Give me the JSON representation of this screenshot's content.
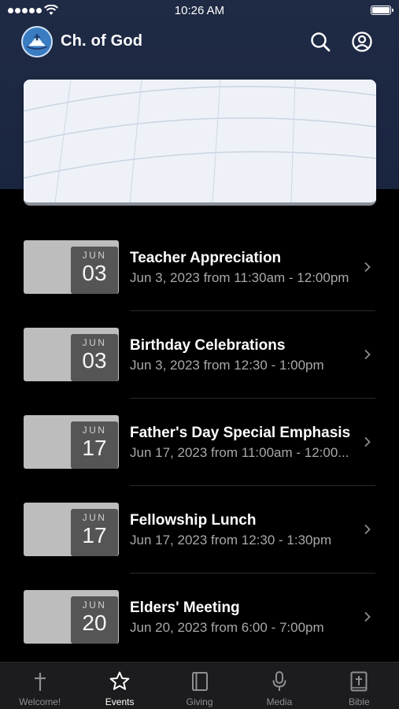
{
  "status_bar": {
    "time": "10:26 AM"
  },
  "header": {
    "title": "Ch. of God"
  },
  "events": [
    {
      "month": "JUN",
      "day": "03",
      "title": "Teacher Appreciation",
      "time": "Jun 3, 2023 from 11:30am - 12:00pm"
    },
    {
      "month": "JUN",
      "day": "03",
      "title": "Birthday Celebrations",
      "time": "Jun 3, 2023 from 12:30 - 1:00pm"
    },
    {
      "month": "JUN",
      "day": "17",
      "title": "Father's Day Special Emphasis",
      "time": "Jun 17, 2023 from 11:00am - 12:00..."
    },
    {
      "month": "JUN",
      "day": "17",
      "title": "Fellowship Lunch",
      "time": "Jun 17, 2023 from 12:30 - 1:30pm"
    },
    {
      "month": "JUN",
      "day": "20",
      "title": "Elders' Meeting",
      "time": "Jun 20, 2023 from 6:00 - 7:00pm"
    }
  ],
  "tabs": [
    {
      "label": "Welcome!",
      "icon": "cross-icon",
      "active": false
    },
    {
      "label": "Events",
      "icon": "star-icon",
      "active": true
    },
    {
      "label": "Giving",
      "icon": "book-outline-icon",
      "active": false
    },
    {
      "label": "Media",
      "icon": "microphone-icon",
      "active": false
    },
    {
      "label": "Bible",
      "icon": "bible-icon",
      "active": false
    }
  ],
  "colors": {
    "header_bg": "#1f2a45",
    "list_bg": "#000000",
    "tab_bar_bg": "#1c1c1e",
    "date_box": "#555555",
    "thumb": "#bdbdbd"
  }
}
